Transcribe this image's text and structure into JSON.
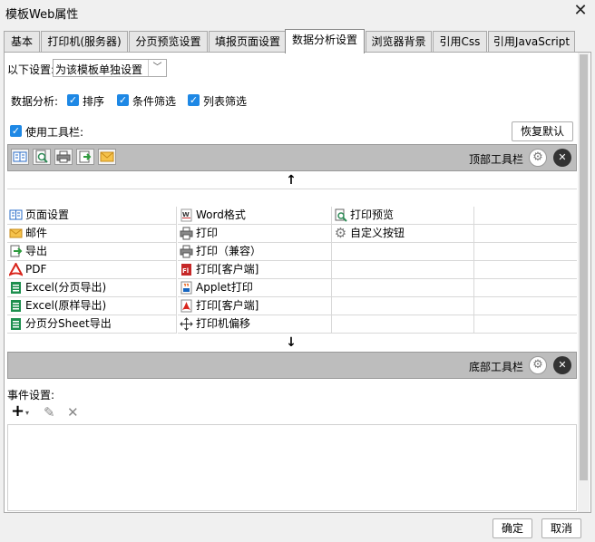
{
  "window": {
    "title": "模板Web属性",
    "close_glyph": "✕"
  },
  "tabs": [
    "基本",
    "打印机(服务器)",
    "分页预览设置",
    "填报页面设置",
    "数据分析设置",
    "浏览器背景",
    "引用Css",
    "引用JavaScript"
  ],
  "active_tab": "数据分析设置",
  "settings": {
    "label": "以下设置:",
    "select_value": "为该模板单独设置"
  },
  "data_analysis": {
    "label": "数据分析:",
    "options": [
      {
        "label": "排序",
        "checked": true
      },
      {
        "label": "条件筛选",
        "checked": true
      },
      {
        "label": "列表筛选",
        "checked": true
      }
    ]
  },
  "toolbar_section": {
    "use_toolbar_label": "使用工具栏:",
    "use_toolbar_checked": true,
    "restore_button": "恢复默认"
  },
  "top_toolbar": {
    "label": "顶部工具栏",
    "icons": [
      "page-setup-icon",
      "print-preview-icon",
      "print-icon",
      "export-icon",
      "email-icon"
    ]
  },
  "bottom_toolbar": {
    "label": "底部工具栏"
  },
  "toolbar_items": {
    "col1": [
      {
        "icon": "page-setup-icon",
        "label": "页面设置"
      },
      {
        "icon": "email-icon",
        "label": "邮件"
      },
      {
        "icon": "export-icon",
        "label": "导出"
      },
      {
        "icon": "pdf-icon",
        "label": "PDF"
      },
      {
        "icon": "excel-icon",
        "label": "Excel(分页导出)"
      },
      {
        "icon": "excel-icon",
        "label": "Excel(原样导出)"
      },
      {
        "icon": "excel-icon",
        "label": "分页分Sheet导出"
      }
    ],
    "col2": [
      {
        "icon": "word-icon",
        "label": "Word格式"
      },
      {
        "icon": "print-icon",
        "label": "打印"
      },
      {
        "icon": "print-icon",
        "label": "打印（兼容）"
      },
      {
        "icon": "flash-print-icon",
        "label": "打印[客户端]"
      },
      {
        "icon": "applet-print-icon",
        "label": "Applet打印"
      },
      {
        "icon": "pdf-print-icon",
        "label": "打印[客户端]"
      },
      {
        "icon": "move-icon",
        "label": "打印机偏移"
      }
    ],
    "col3": [
      {
        "icon": "print-preview-icon",
        "label": "打印预览"
      },
      {
        "icon": "gear-icon",
        "label": "自定义按钮"
      }
    ]
  },
  "arrows": {
    "up": "↑",
    "down": "↓"
  },
  "events": {
    "label": "事件设置:",
    "add_glyph": "+",
    "edit_glyph": "✎",
    "delete_glyph": "✕"
  },
  "footer": {
    "ok": "确定",
    "cancel": "取消"
  },
  "colors": {
    "checkbox": "#1e88e5",
    "toolbar_strip": "#bdbdbd"
  }
}
